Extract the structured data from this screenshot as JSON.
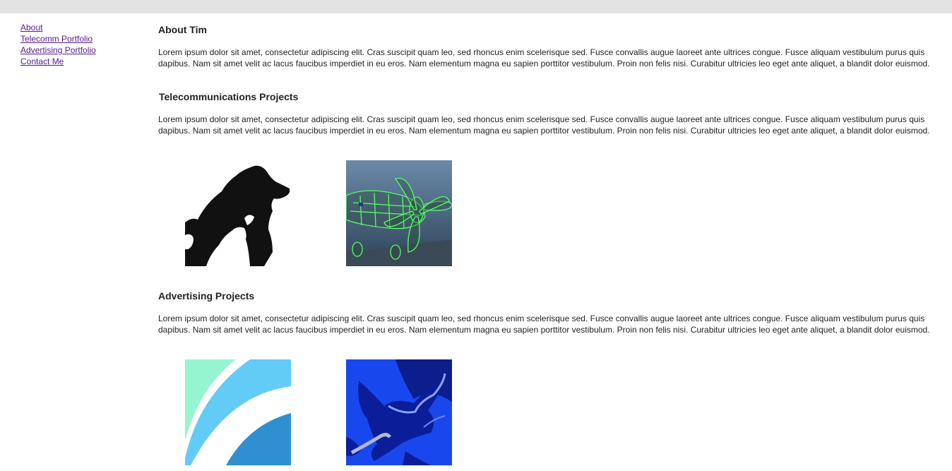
{
  "nav": {
    "items": [
      {
        "label": "About"
      },
      {
        "label": "Telecomm Portfolio"
      },
      {
        "label": "Advertising Portfolio"
      },
      {
        "label": "Contact Me"
      }
    ]
  },
  "main": {
    "sections": [
      {
        "title": "About Tim",
        "body": "Lorem ipsum dolor sit amet, consectetur adipiscing elit. Cras suscipit quam leo, sed rhoncus enim scelerisque sed. Fusce convallis augue laoreet ante ultrices congue. Fusce aliquam vestibulum purus quis dapibus. Nam sit amet velit ac lacus faucibus imperdiet in eu eros. Nam elementum magna eu sapien porttitor vestibulum. Proin non felis nisi. Curabitur ultricies leo eget ante aliquet, a blandit dolor euismod."
      },
      {
        "title": "Telecommunications Projects",
        "body": "Lorem ipsum dolor sit amet, consectetur adipiscing elit. Cras suscipit quam leo, sed rhoncus enim scelerisque sed. Fusce convallis augue laoreet ante ultrices congue. Fusce aliquam vestibulum purus quis dapibus. Nam sit amet velit ac lacus faucibus imperdiet in eu eros. Nam elementum magna eu sapien porttitor vestibulum. Proin non felis nisi. Curabitur ultricies leo eget ante aliquet, a blandit dolor euismod.",
        "thumbnails": [
          {
            "icon": "dog-cat-silhouette-icon"
          },
          {
            "icon": "wireframe-airplane-icon"
          }
        ]
      },
      {
        "title": "Advertising Projects",
        "body": "Lorem ipsum dolor sit amet, consectetur adipiscing elit. Cras suscipit quam leo, sed rhoncus enim scelerisque sed. Fusce convallis augue laoreet ante ultrices congue. Fusce aliquam vestibulum purus quis dapibus. Nam sit amet velit ac lacus faucibus imperdiet in eu eros. Nam elementum magna eu sapien porttitor vestibulum. Proin non felis nisi. Curabitur ultricies leo eget ante aliquet, a blandit dolor euismod.",
        "thumbnails": [
          {
            "icon": "blue-arcs-logo-icon"
          },
          {
            "icon": "blue-bird-illustration-icon"
          }
        ]
      }
    ]
  },
  "colors": {
    "topbar": "#e3e3e3",
    "link": "#551a8b",
    "text": "#222222"
  }
}
